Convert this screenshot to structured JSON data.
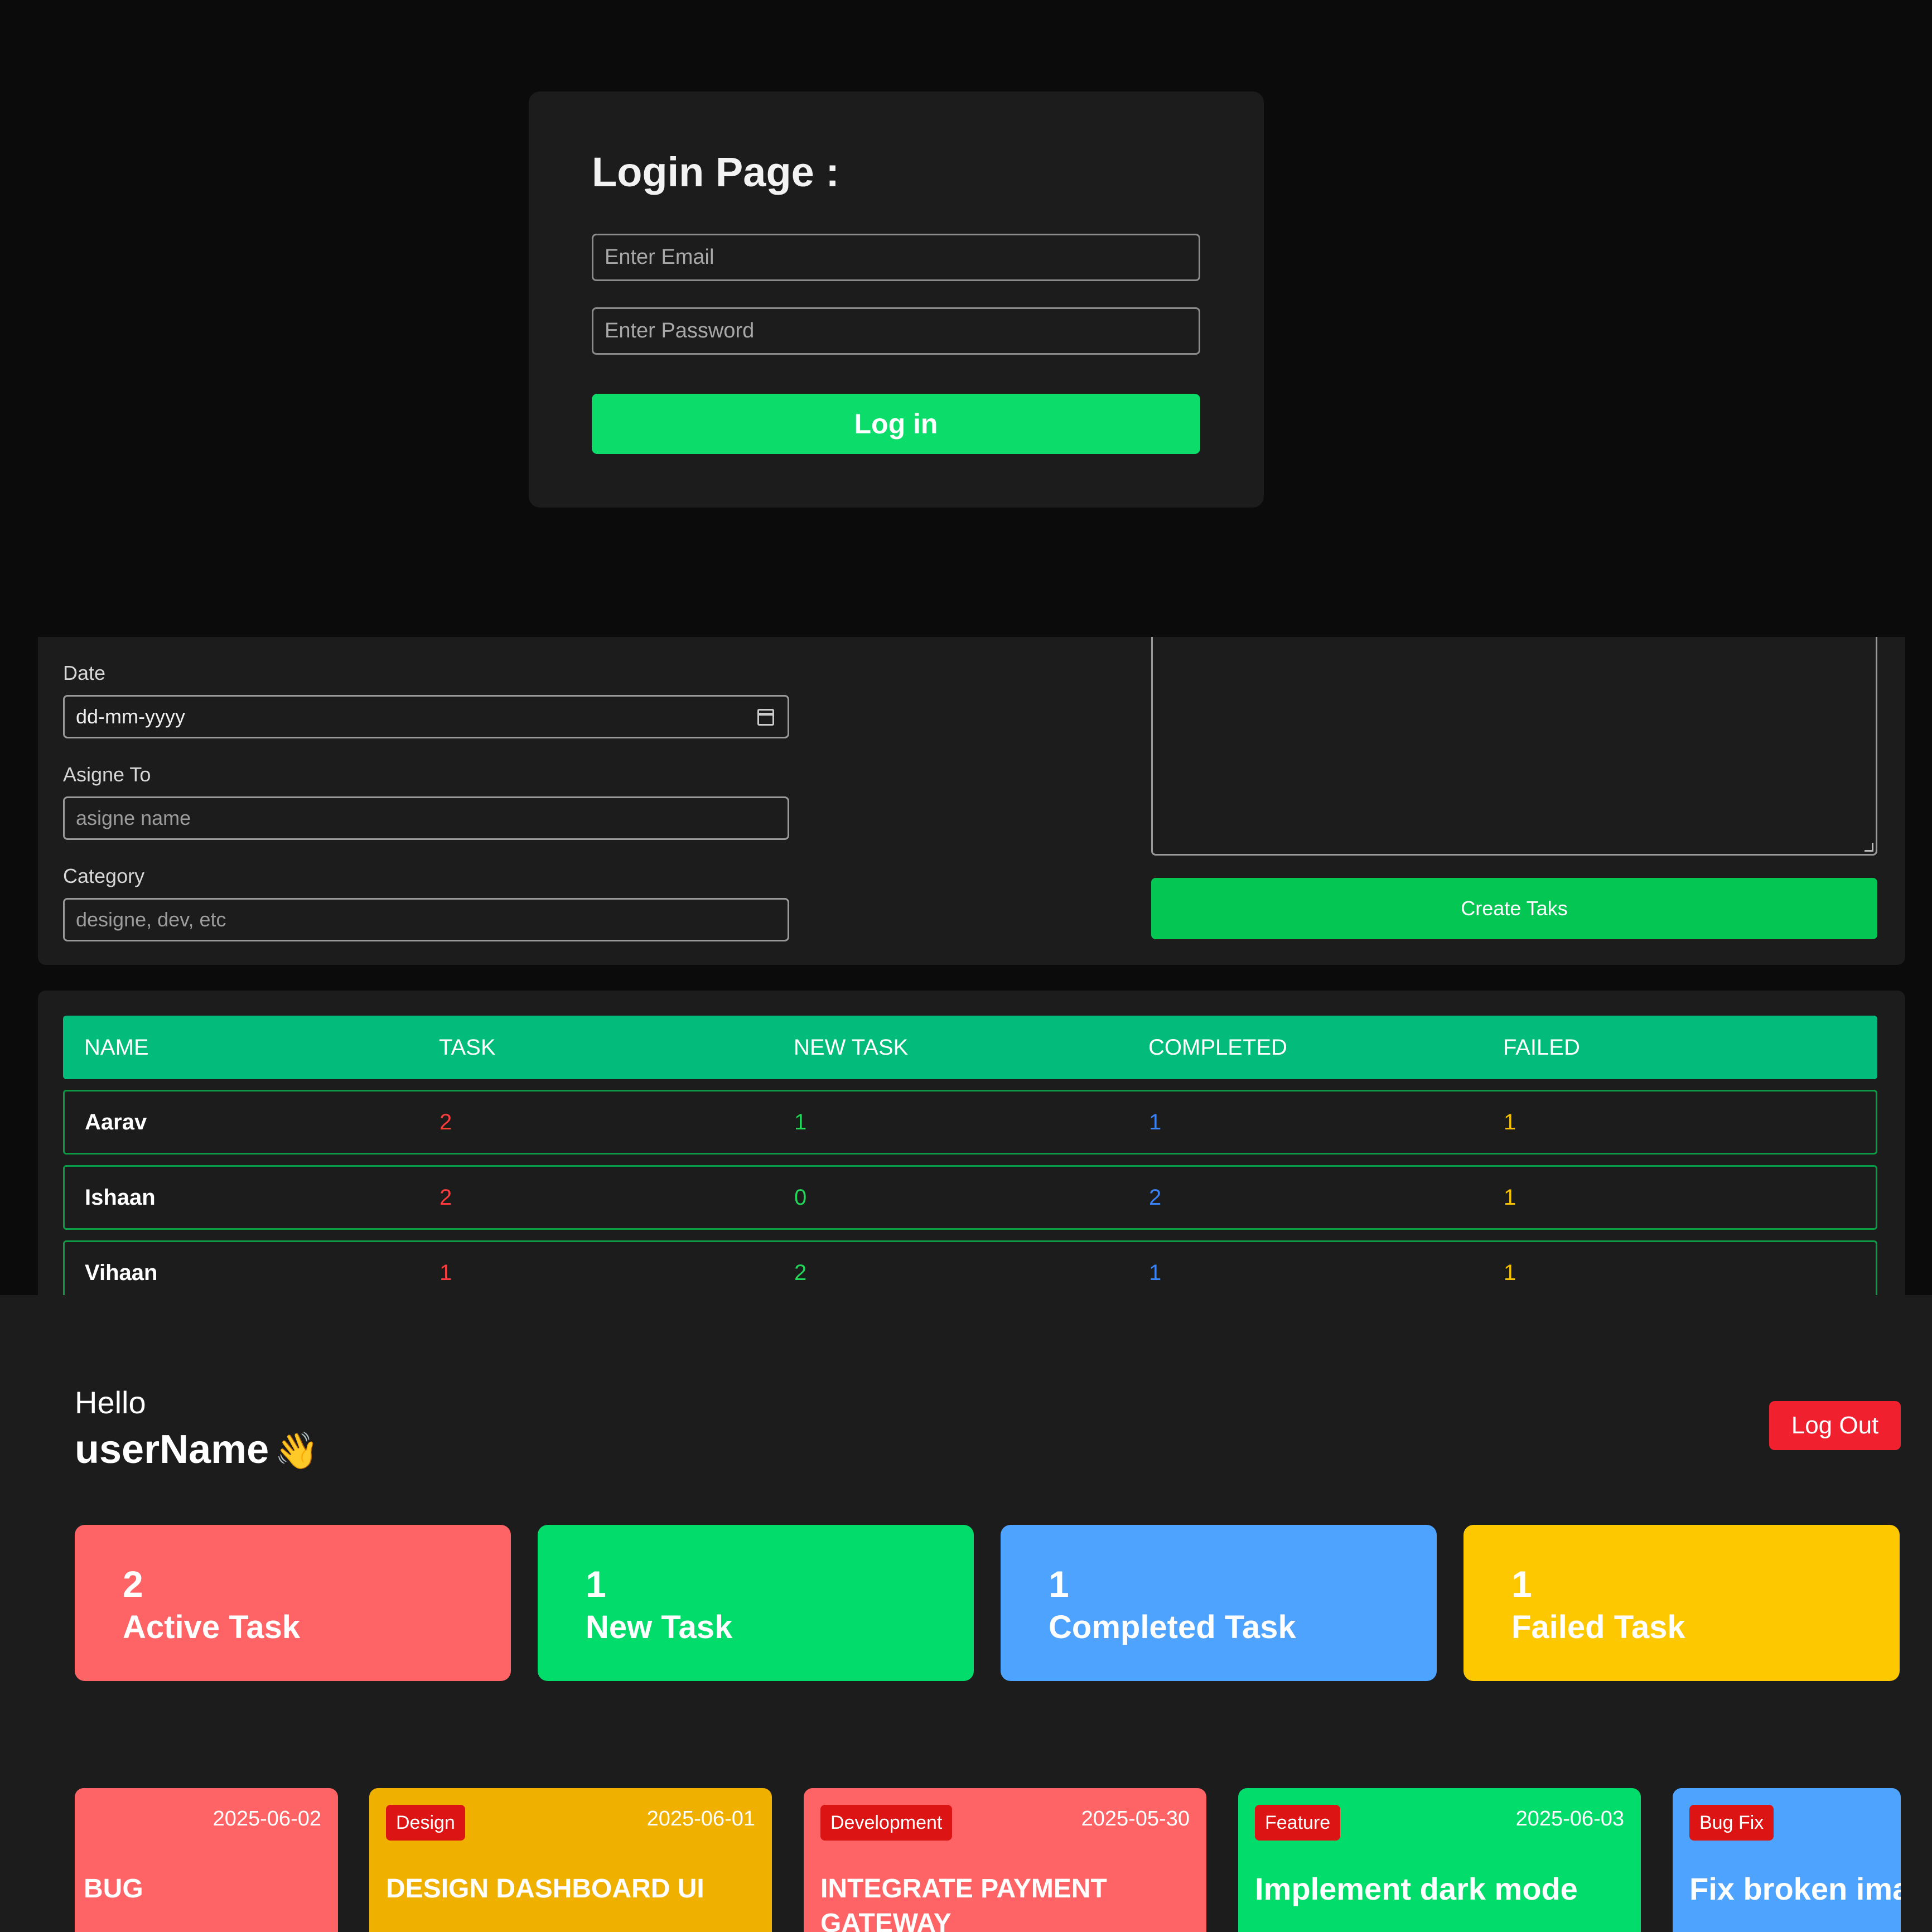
{
  "login": {
    "title": "Login Page :",
    "email_placeholder": "Enter Email",
    "password_placeholder": "Enter Password",
    "button_label": "Log in"
  },
  "create_task": {
    "date_label": "Date",
    "date_value": "dd-mm-yyyy",
    "assignee_label": "Asigne To",
    "assignee_placeholder": "asigne name",
    "category_label": "Category",
    "category_placeholder": "designe, dev, etc",
    "button_label": "Create Taks"
  },
  "table": {
    "headers": [
      "NAME",
      "TASK",
      "NEW TASK",
      "COMPLETED",
      "FAILED"
    ],
    "rows": [
      {
        "name": "Aarav",
        "task": "2",
        "new_task": "1",
        "completed": "1",
        "failed": "1"
      },
      {
        "name": "Ishaan",
        "task": "2",
        "new_task": "0",
        "completed": "2",
        "failed": "1"
      },
      {
        "name": "Vihaan",
        "task": "1",
        "new_task": "2",
        "completed": "1",
        "failed": "1"
      }
    ]
  },
  "employee": {
    "greeting": "Hello",
    "username": "userName",
    "wave_emoji": "👋",
    "logout_label": "Log Out",
    "stats": [
      {
        "count": "2",
        "label": "Active Task",
        "color": "#fe6466"
      },
      {
        "count": "1",
        "label": "New Task",
        "color": "#02dc6a"
      },
      {
        "count": "1",
        "label": "Completed Task",
        "color": "#4ea3ff"
      },
      {
        "count": "1",
        "label": "Failed Task",
        "color": "#fec801"
      }
    ],
    "tasks": [
      {
        "category": "",
        "date": "2025-06-02",
        "title": "BUG",
        "description": "...",
        "color": "#fe6466"
      },
      {
        "category": "Design",
        "date": "2025-06-01",
        "title": "DESIGN DASHBOARD UI",
        "description": "",
        "color": "#f0b000"
      },
      {
        "category": "Development",
        "date": "2025-05-30",
        "title": "INTEGRATE PAYMENT GATEWAY",
        "description": "",
        "color": "#fe6466"
      },
      {
        "category": "Feature",
        "date": "2025-06-03",
        "title": "Implement dark mode",
        "description": "",
        "color": "#02dc6a"
      },
      {
        "category": "Bug Fix",
        "date": "",
        "title": "Fix broken ima",
        "description": "",
        "color": "#4ea3ff"
      }
    ]
  }
}
